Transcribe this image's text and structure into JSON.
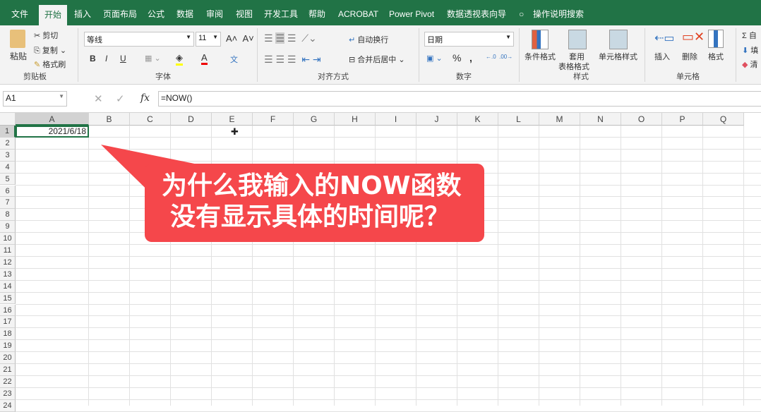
{
  "tabs": [
    "文件",
    "开始",
    "插入",
    "页面布局",
    "公式",
    "数据",
    "审阅",
    "视图",
    "开发工具",
    "帮助",
    "ACROBAT",
    "Power Pivot",
    "数据透视表向导",
    "操作说明搜索"
  ],
  "clipboard": {
    "paste": "粘贴",
    "cut": "剪切",
    "copy": "复制",
    "format_painter": "格式刷",
    "group": "剪贴板"
  },
  "font": {
    "name": "等线",
    "size": "11",
    "bold": "B",
    "italic": "I",
    "underline": "U",
    "color": "A",
    "phonetic": "文",
    "group": "字体"
  },
  "align": {
    "wrap": "自动换行",
    "merge": "合并后居中",
    "group": "对齐方式"
  },
  "number": {
    "format": "日期",
    "percent": "%",
    "comma": ",",
    "group": "数字"
  },
  "styles": {
    "cond": "条件格式",
    "table1": "套用",
    "table2": "表格格式",
    "cell": "单元格样式",
    "group": "样式"
  },
  "cells": {
    "insert": "插入",
    "delete": "删除",
    "format": "格式",
    "group": "单元格"
  },
  "editing": {
    "sum": "自",
    "fill": "填",
    "clear": "清"
  },
  "formula_bar": {
    "name_box": "A1",
    "formula": "=NOW()",
    "fx": "fx"
  },
  "columns": [
    "A",
    "B",
    "C",
    "D",
    "E",
    "F",
    "G",
    "H",
    "I",
    "J",
    "K",
    "L",
    "M",
    "N",
    "O",
    "P",
    "Q"
  ],
  "rows": [
    "1",
    "2",
    "3",
    "4",
    "5",
    "6",
    "7",
    "8",
    "9",
    "10",
    "11",
    "12",
    "13",
    "14",
    "15",
    "16",
    "17",
    "18",
    "19",
    "20",
    "21",
    "22",
    "23",
    "24"
  ],
  "cell_a1": "2021/6/18",
  "callout": {
    "line1": "为什么我输入的NOW函数",
    "line2": "没有显示具体的时间呢？"
  }
}
